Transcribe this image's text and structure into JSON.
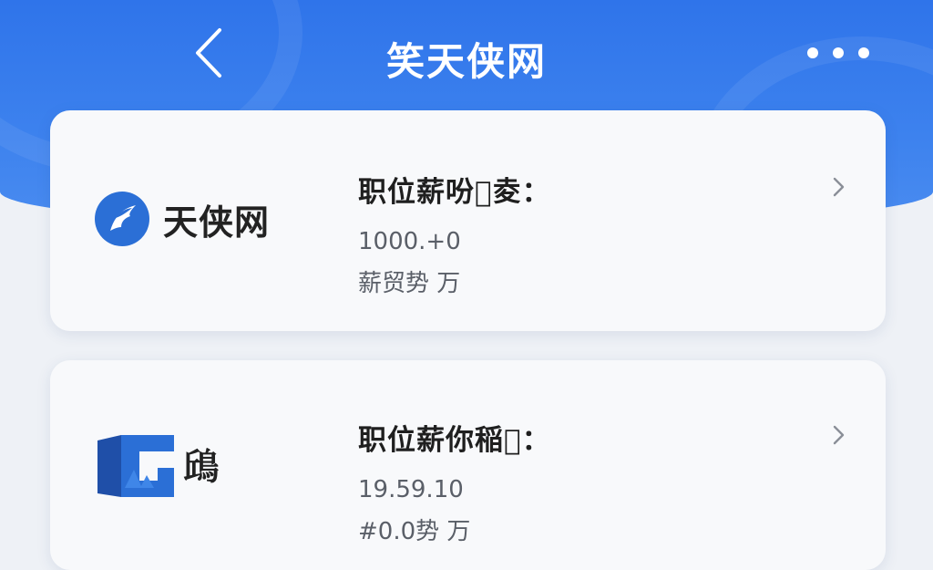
{
  "header": {
    "title": "笑天侠网",
    "back_icon": "chevron-left-icon",
    "more_icon": "more-dots-icon"
  },
  "cards": [
    {
      "logo_icon": "tianxia-logo-icon",
      "logo_text": "天侠网",
      "title": "职位薪吩𫄣夌：",
      "value": "1000.+0",
      "sub": "薪贸势 万"
    },
    {
      "logo_icon": "square-logo-icon",
      "logo_text": "𩿨",
      "title": "职位薪你稲𫝋：",
      "value": "19.59.10",
      "sub": "#0.0势 万"
    }
  ],
  "colors": {
    "header_blue": "#2f74ea",
    "card_bg": "#f8f9fb",
    "logo_blue": "#2b6fd6"
  }
}
